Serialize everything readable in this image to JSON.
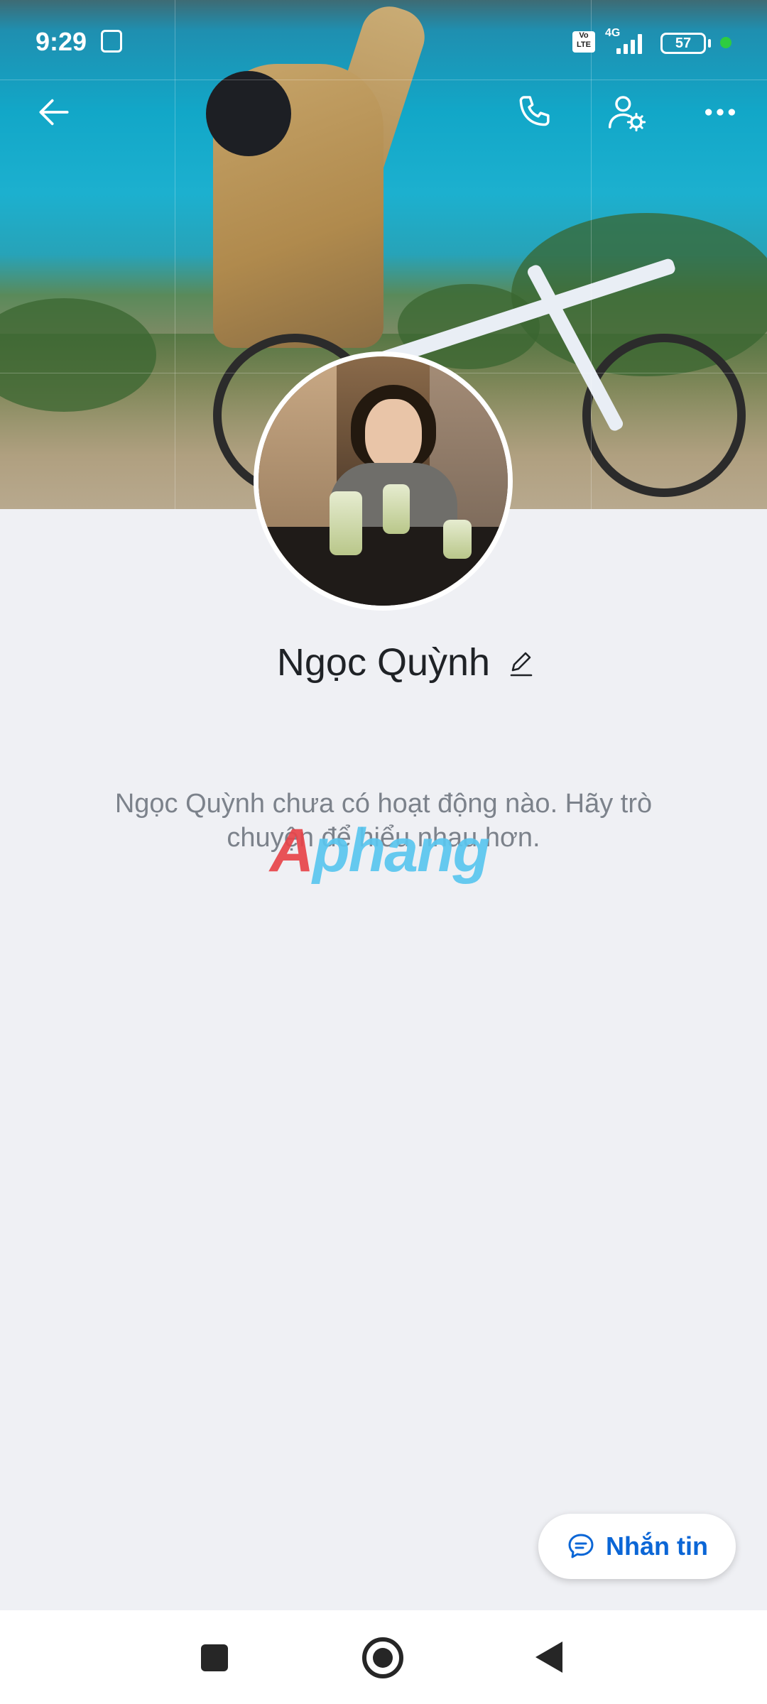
{
  "status_bar": {
    "time": "9:29",
    "volte_label": "Vo\nLTE",
    "network_label": "4G",
    "battery_level": "57",
    "signal_bars": 4
  },
  "top_bar": {
    "back_icon": "arrow-left-icon",
    "call_icon": "phone-icon",
    "settings_icon": "user-settings-icon",
    "more_icon": "more-dots-icon"
  },
  "profile": {
    "name": "Ngọc Quỳnh",
    "empty_state": "Ngọc Quỳnh chưa có hoạt động nào. Hãy trò chuyện để hiểu nhau hơn."
  },
  "watermark": {
    "text_red": "A",
    "text_blue": "phang"
  },
  "actions": {
    "message_label": "Nhắn tin"
  },
  "colors": {
    "accent": "#0b66d6",
    "background": "#eff0f4",
    "text_primary": "#1f2226",
    "text_secondary": "#7c828b"
  }
}
